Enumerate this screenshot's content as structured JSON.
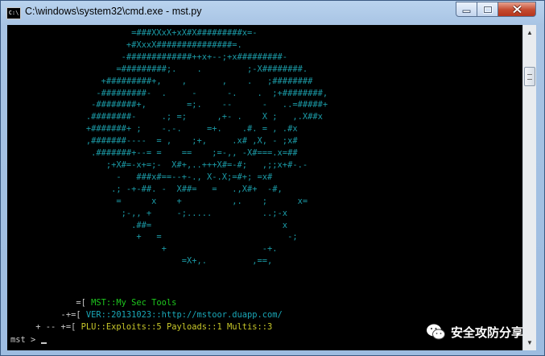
{
  "window": {
    "title": "C:\\windows\\system32\\cmd.exe - mst.py",
    "icon_label": "C:\\"
  },
  "controls": {
    "minimize": "minimize",
    "maximize": "maximize",
    "close": "close"
  },
  "console": {
    "art_lines": [
      "                        =###XXxX+xX#X#########x=-",
      "                       +#XxxX###############=.",
      "                      -#############++x+--;+x#########-",
      "                     =#########;.    .         ;-X########.",
      "                  +#########+,    ,       ,    .   ;########",
      "                 -#########-  .     -      -.    .  ;+########,",
      "                -########+,        =;.    --      -   ..=#####+",
      "               .########-     .; =;      ,+- .    X ;   ,.X##x",
      "               +#######+ ;    -.-.     =+.    .#. = , .#x",
      "               ,#######----  = ,    ;+,     .x# ,X, - ;x#",
      "                .#######+--= =    ==    ;=-,, -X#===.x=##",
      "                   ;+X#=-x+=;-  X#+,..+++X#=-#;   ,;;x+#-.-",
      "                     -   ###x#==--+-., X-.X;=#+; =x#",
      "                    .; -+-##. -  X##=   =   .,X#+  -#,",
      "                     =      x    +          ,.    ;      x=",
      "                      ;-,, +     -;.....          ..;-x",
      "                        .##=                          x",
      "                         +   =                         -;",
      "                              +                   -+.",
      "                                  =X+,.         ,==,"
    ],
    "info": [
      {
        "bracket": "             =[ ",
        "label": "MST::My Sec Tools"
      },
      {
        "bracket": "          -+=[ ",
        "label": "VER::20131023::http://mstoor.duapp.com/"
      },
      {
        "bracket": "     + -- +=[ ",
        "label": "PLU::Exploits::5 Payloads::1 Multis::3"
      }
    ],
    "prompt": "mst > "
  },
  "watermark": {
    "text": "安全攻防分享"
  },
  "colors": {
    "art": "#1b9aa6",
    "label_green": "#1ec81e",
    "label_cyan": "#1aa8b8",
    "label_yellow": "#c8c82a",
    "console_bg": "#000000"
  }
}
